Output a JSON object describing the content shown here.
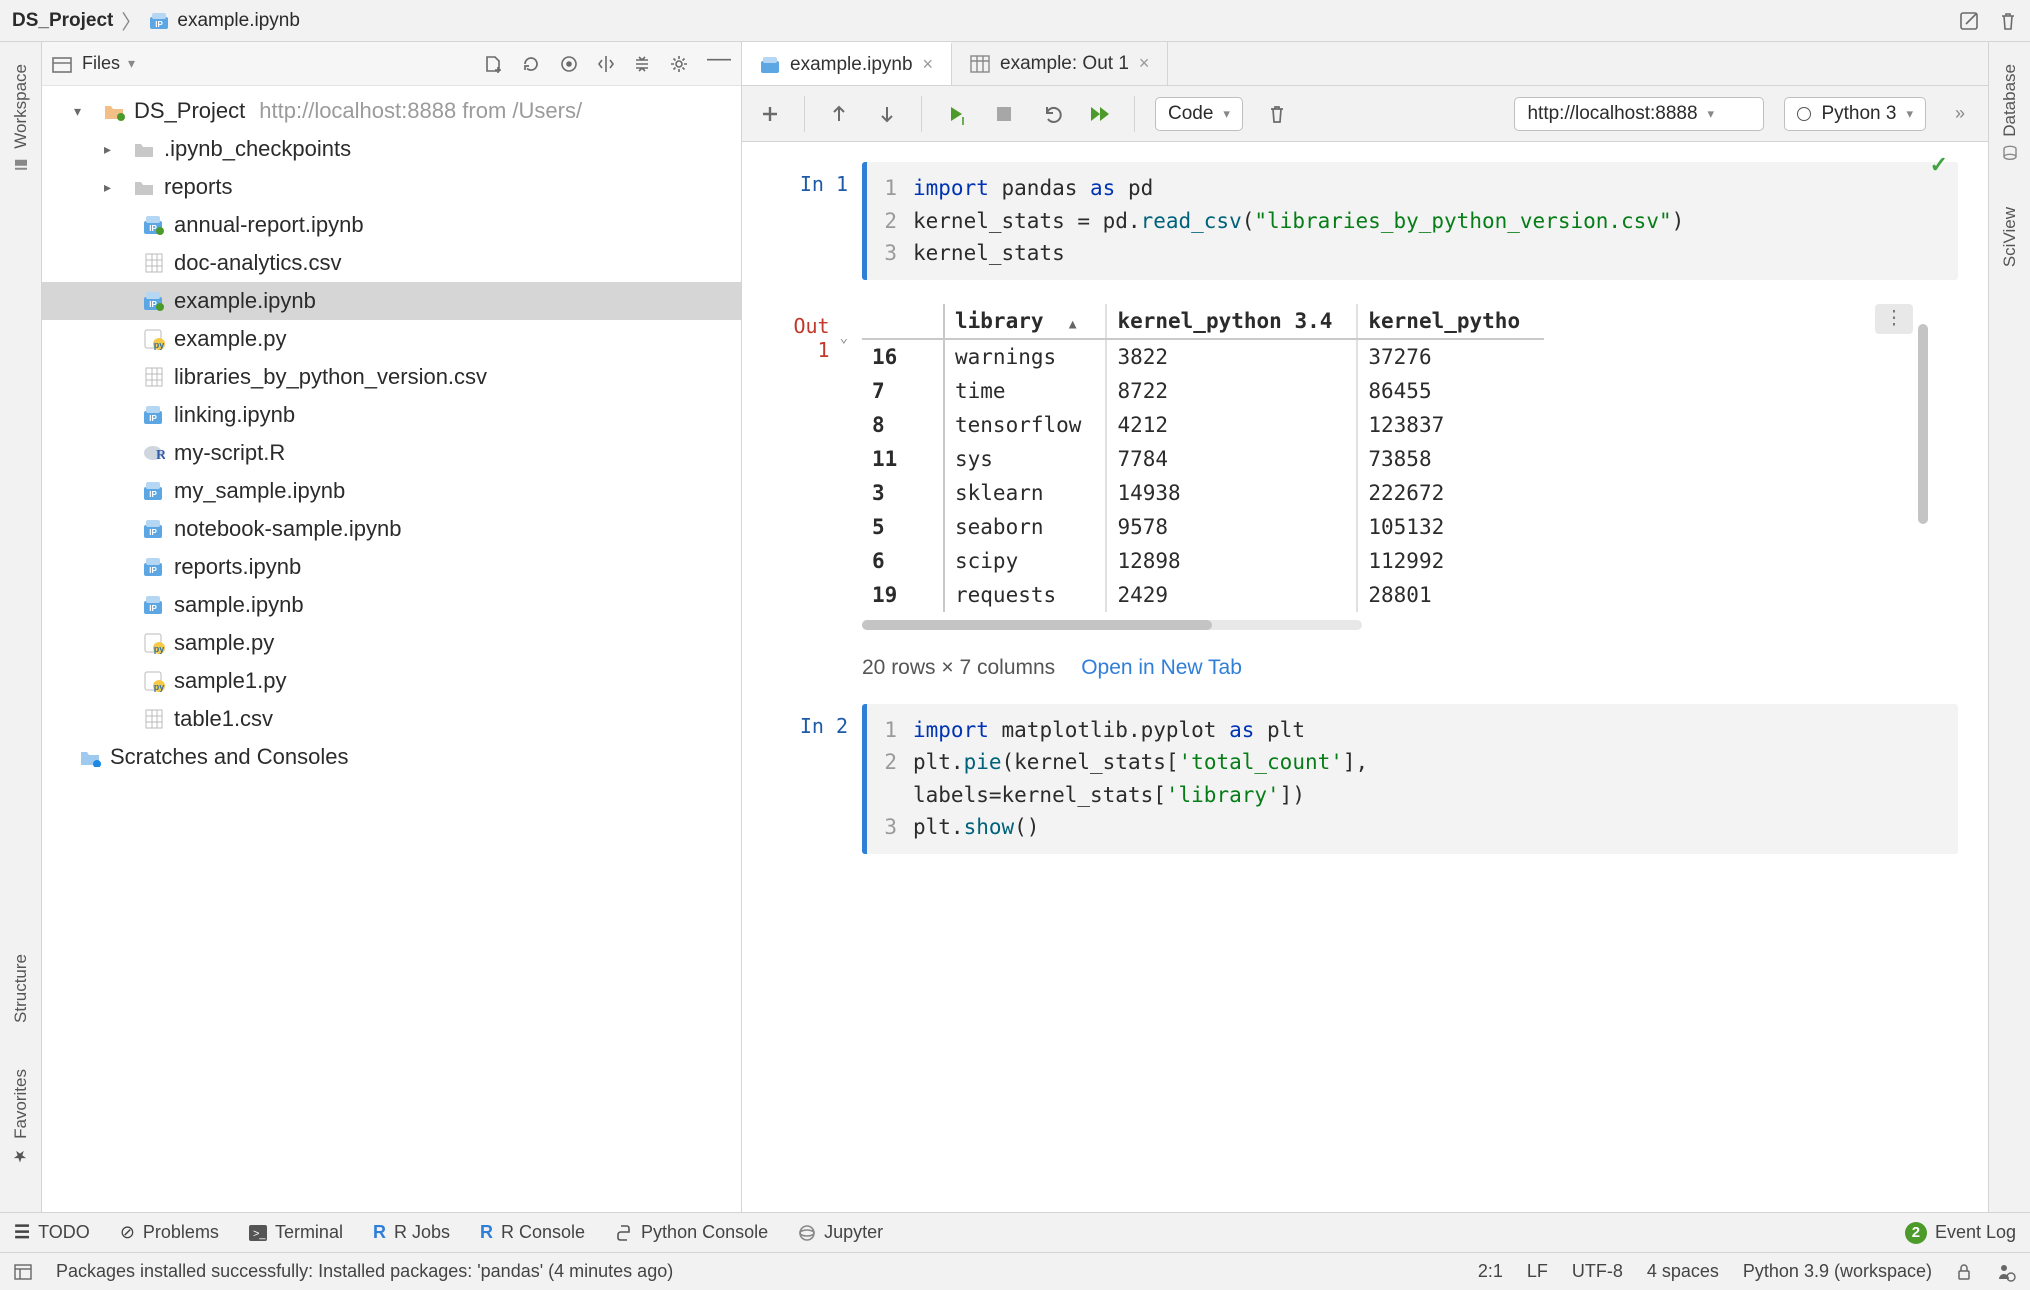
{
  "breadcrumb": {
    "project": "DS_Project",
    "file": "example.ipynb"
  },
  "left_bar": {
    "workspace": "Workspace",
    "structure": "Structure",
    "favorites": "Favorites"
  },
  "right_bar": {
    "database": "Database",
    "sciview": "SciView"
  },
  "files_panel": {
    "title": "Files",
    "root_name": "DS_Project",
    "root_subtitle": "http://localhost:8888 from /Users/",
    "folders": [
      {
        "name": ".ipynb_checkpoints"
      },
      {
        "name": "reports"
      }
    ],
    "files": [
      {
        "name": "annual-report.ipynb",
        "type": "nb-run"
      },
      {
        "name": "doc-analytics.csv",
        "type": "csv"
      },
      {
        "name": "example.ipynb",
        "type": "nb-run",
        "selected": true
      },
      {
        "name": "example.py",
        "type": "py"
      },
      {
        "name": "libraries_by_python_version.csv",
        "type": "csv"
      },
      {
        "name": "linking.ipynb",
        "type": "nb"
      },
      {
        "name": "my-script.R",
        "type": "r"
      },
      {
        "name": "my_sample.ipynb",
        "type": "nb"
      },
      {
        "name": "notebook-sample.ipynb",
        "type": "nb"
      },
      {
        "name": "reports.ipynb",
        "type": "nb"
      },
      {
        "name": "sample.ipynb",
        "type": "nb"
      },
      {
        "name": "sample.py",
        "type": "py"
      },
      {
        "name": "sample1.py",
        "type": "py"
      },
      {
        "name": "table1.csv",
        "type": "csv"
      }
    ],
    "scratches": "Scratches and Consoles"
  },
  "tabs": [
    {
      "label": "example.ipynb",
      "kind": "nb",
      "active": true
    },
    {
      "label": "example: Out 1",
      "kind": "table",
      "active": false
    }
  ],
  "nb_toolbar": {
    "cell_type": "Code",
    "server": "http://localhost:8888",
    "kernel": "Python 3"
  },
  "cells": {
    "in1": {
      "prompt": "In 1",
      "lines": [
        [
          {
            "t": "import ",
            "c": "kw"
          },
          {
            "t": "pandas ",
            "c": ""
          },
          {
            "t": "as ",
            "c": "kw"
          },
          {
            "t": "pd",
            "c": ""
          }
        ],
        [
          {
            "t": "kernel_stats = pd.",
            "c": ""
          },
          {
            "t": "read_csv",
            "c": "fn"
          },
          {
            "t": "(",
            "c": ""
          },
          {
            "t": "\"libraries_by_python_version.csv\"",
            "c": "str"
          },
          {
            "t": ")",
            "c": ""
          }
        ],
        [
          {
            "t": "kernel_stats",
            "c": ""
          }
        ]
      ]
    },
    "out1": {
      "prompt": "Out 1",
      "columns": [
        "library",
        "kernel_python 3.4",
        "kernel_pytho"
      ],
      "rows": [
        {
          "idx": "16",
          "vals": [
            "warnings",
            "3822",
            "37276"
          ]
        },
        {
          "idx": "7",
          "vals": [
            "time",
            "8722",
            "86455"
          ]
        },
        {
          "idx": "8",
          "vals": [
            "tensorflow",
            "4212",
            "123837"
          ]
        },
        {
          "idx": "11",
          "vals": [
            "sys",
            "7784",
            "73858"
          ]
        },
        {
          "idx": "3",
          "vals": [
            "sklearn",
            "14938",
            "222672"
          ]
        },
        {
          "idx": "5",
          "vals": [
            "seaborn",
            "9578",
            "105132"
          ]
        },
        {
          "idx": "6",
          "vals": [
            "scipy",
            "12898",
            "112992"
          ]
        },
        {
          "idx": "19",
          "vals": [
            "requests",
            "2429",
            "28801"
          ]
        }
      ],
      "summary": "20 rows × 7 columns",
      "open_link": "Open in New Tab"
    },
    "in2": {
      "prompt": "In 2",
      "lines": [
        [
          {
            "t": "import ",
            "c": "kw"
          },
          {
            "t": "matplotlib.pyplot ",
            "c": ""
          },
          {
            "t": "as ",
            "c": "kw"
          },
          {
            "t": "plt",
            "c": ""
          }
        ],
        [
          {
            "t": "plt.",
            "c": ""
          },
          {
            "t": "pie",
            "c": "fn"
          },
          {
            "t": "(kernel_stats[",
            "c": ""
          },
          {
            "t": "'total_count'",
            "c": "str"
          },
          {
            "t": "],",
            "c": ""
          }
        ],
        [
          {
            "t": "  labels",
            "c": ""
          },
          {
            "t": "=kernel_stats[",
            "c": ""
          },
          {
            "t": "'library'",
            "c": "str"
          },
          {
            "t": "])",
            "c": ""
          }
        ],
        [
          {
            "t": "plt.",
            "c": ""
          },
          {
            "t": "show",
            "c": "fn"
          },
          {
            "t": "()",
            "c": ""
          }
        ]
      ],
      "gutters": [
        "1",
        "2",
        "",
        "3"
      ]
    }
  },
  "bottom": {
    "todo": "TODO",
    "problems": "Problems",
    "terminal": "Terminal",
    "rjobs": "R Jobs",
    "rconsole": "R Console",
    "pyconsole": "Python Console",
    "jupyter": "Jupyter",
    "eventlog": "Event Log",
    "event_badge": "2"
  },
  "status": {
    "msg": "Packages installed successfully: Installed packages: 'pandas' (4 minutes ago)",
    "pos": "2:1",
    "eol": "LF",
    "enc": "UTF-8",
    "indent": "4 spaces",
    "interp": "Python 3.9 (workspace)"
  }
}
